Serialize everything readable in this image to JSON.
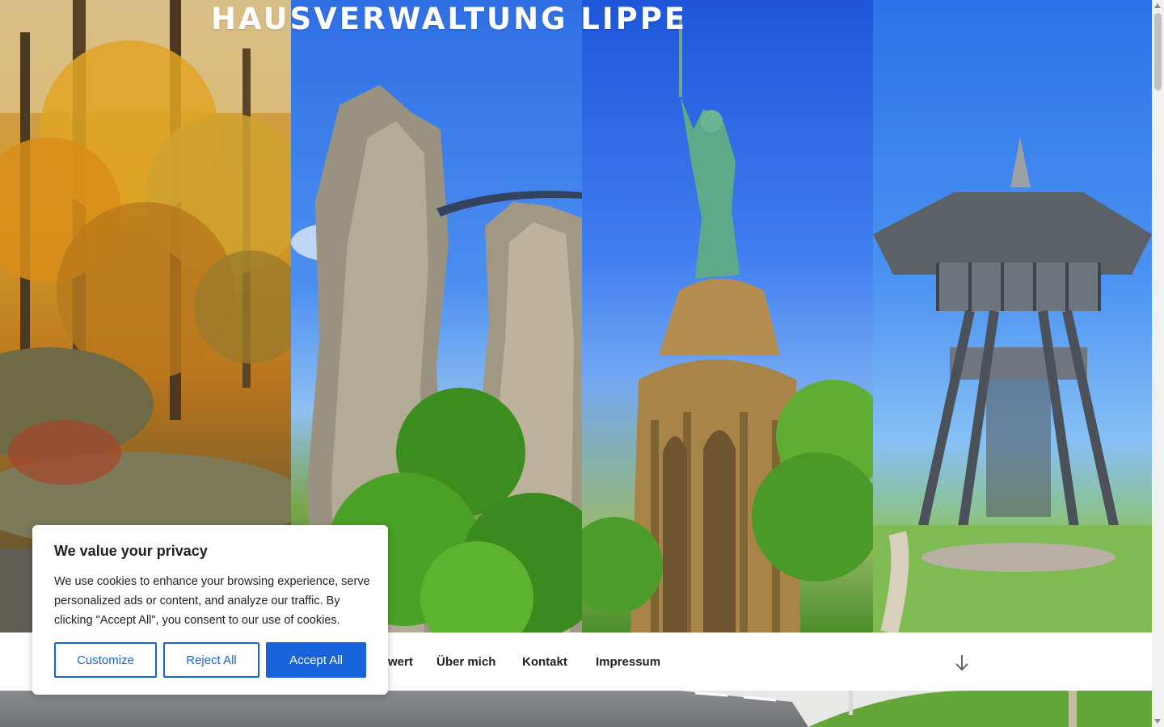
{
  "site": {
    "title": "HAUSVERWALTUNG LIPPE"
  },
  "hero": {
    "images": [
      {
        "icon": "autumn-forest-image"
      },
      {
        "icon": "externsteine-rocks-image"
      },
      {
        "icon": "hermannsdenkmal-statue-image"
      },
      {
        "icon": "lookout-tower-image"
      }
    ]
  },
  "nav": {
    "items": [
      {
        "label": "wert"
      },
      {
        "label": "Über mich"
      },
      {
        "label": "Kontakt"
      },
      {
        "label": "Impressum"
      }
    ],
    "scroll_icon": "arrow-down-icon"
  },
  "cookie": {
    "title": "We value your privacy",
    "body": "We use cookies to enhance your browsing experience, serve personalized ads or content, and analyze our traffic. By clicking \"Accept All\", you consent to our use of cookies.",
    "customize_label": "Customize",
    "reject_label": "Reject All",
    "accept_label": "Accept All"
  },
  "colors": {
    "accent": "#1863dc",
    "nav_text": "#222222",
    "title_text": "#ffffff"
  }
}
